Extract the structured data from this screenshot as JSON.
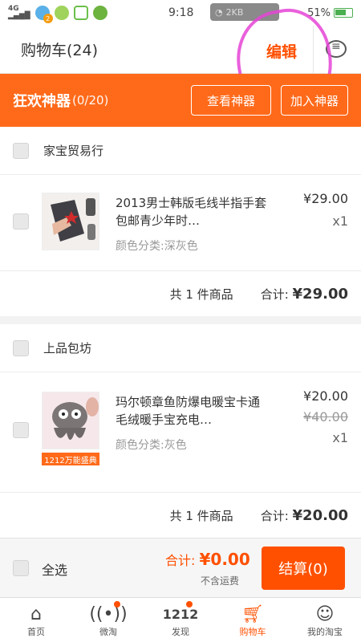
{
  "status": {
    "network": "4G",
    "time": "9:18",
    "notify_count": "2",
    "pill_text": "2KB",
    "battery": "51%"
  },
  "header": {
    "title": "购物车(24)",
    "edit": "编辑"
  },
  "banner": {
    "title": "狂欢神器",
    "count": "(0/20)",
    "view_btn": "查看神器",
    "add_btn": "加入神器"
  },
  "shops": [
    {
      "name": "家宝贸易行",
      "item": {
        "title": "2013男士韩版毛线半指手套包邮青少年时…",
        "spec": "颜色分类:深灰色",
        "price": "¥29.00",
        "qty": "x1"
      },
      "count_text": "共 1 件商品",
      "total_label": "合计:",
      "total": "¥29.00"
    },
    {
      "name": "上品包坊",
      "item": {
        "title": "玛尔顿章鱼防爆电暖宝卡通毛绒暖手宝充电…",
        "spec": "颜色分类:灰色",
        "price": "¥20.00",
        "orig_price": "¥40.00",
        "qty": "x1",
        "promo": "1212万能盛典"
      },
      "count_text": "共 1 件商品",
      "total_label": "合计:",
      "total": "¥20.00"
    }
  ],
  "checkout": {
    "select_all": "全选",
    "sum_label": "合计:",
    "sum_value": "¥0.00",
    "shipping": "不含运费",
    "pay_button": "结算(0)"
  },
  "tabs": [
    {
      "label": "首页",
      "icon": "home-icon"
    },
    {
      "label": "微淘",
      "icon": "broadcast-icon"
    },
    {
      "label": "发现",
      "icon": "1212-icon"
    },
    {
      "label": "购物车",
      "icon": "cart-icon"
    },
    {
      "label": "我的淘宝",
      "icon": "profile-icon"
    }
  ],
  "colors": {
    "accent": "#ff5000",
    "banner": "#ff6a1a"
  }
}
